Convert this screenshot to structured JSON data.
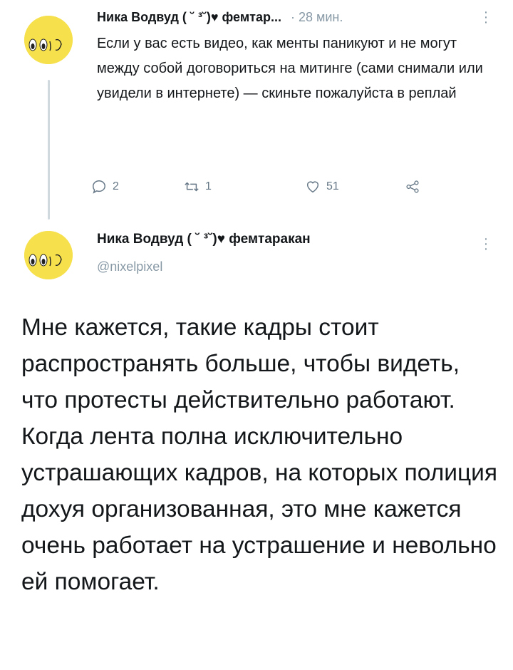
{
  "tweet1": {
    "author_name": "Ника Водвуд ( ˘ ³˘)♥ фемтар...",
    "time": "· 28 мин.",
    "text": "Если у вас есть видео, как менты паникуют и не могут между собой договориться на митинге (сами снимали или увидели в интернете) — скиньте пожалуйста в реплай",
    "actions": {
      "replies": "2",
      "retweets": "1",
      "likes": "51"
    }
  },
  "tweet2": {
    "author_name": "Ника Водвуд ( ˘ ³˘)♥ фемтаракан",
    "handle": "@nixelpixel",
    "text": "Мне кажется, такие кадры стоит распространять больше, чтобы видеть, что протесты действительно работают. Когда лента полна исключительно устрашающих кадров, на которых полиция дохуя организованная, это мне кажется очень работает на устрашение и невольно ей помогает."
  },
  "icons": {
    "more": "more-vertical-icon",
    "reply": "reply-icon",
    "retweet": "retweet-icon",
    "like": "heart-icon",
    "share": "share-icon"
  },
  "colors": {
    "text": "#14171a",
    "muted": "#8899a6",
    "avatar": "#f6e04c"
  }
}
